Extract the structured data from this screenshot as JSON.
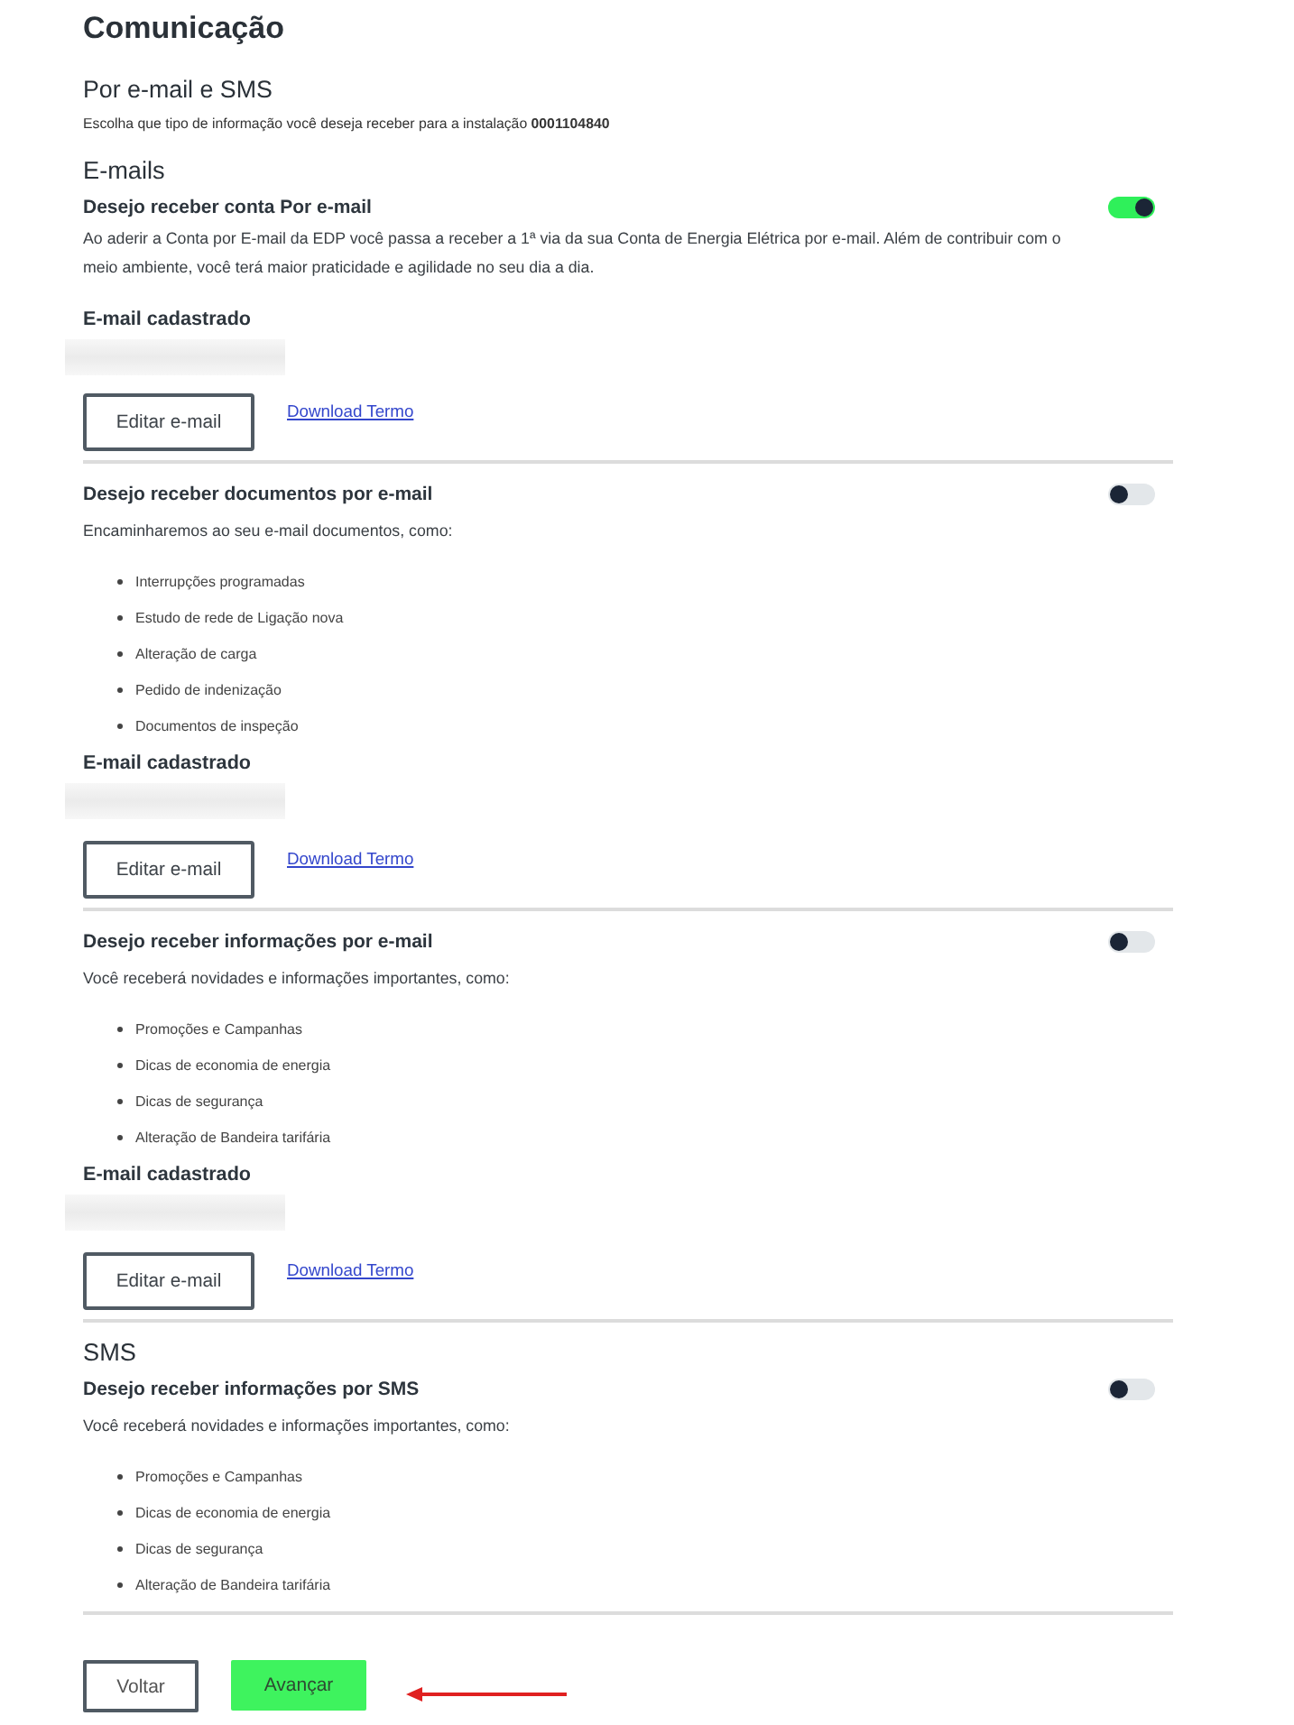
{
  "page": {
    "title": "Comunicação",
    "subtitle": "Por e-mail e SMS",
    "intro": "Escolha que tipo de informação você deseja receber para a instalação **0001104840**"
  },
  "sections": [
    {
      "heading": "E-mails",
      "options": [
        {
          "title": "Desejo receber conta Por e-mail",
          "on": true,
          "description": "Ao aderir a Conta por E-mail da EDP você passa a receber a 1ª via da sua Conta de Energia Elétrica por e-mail. Além de contribuir com o meio ambiente, você terá maior praticidade e agilidade no seu dia a dia.",
          "email": {
            "label": "E-mail cadastrado",
            "edit_button": "Editar e-mail",
            "link": "Download Termo"
          }
        },
        {
          "title": "Desejo receber documentos por e-mail",
          "on": false,
          "description": "Encaminharemos ao seu e-mail documentos, como:",
          "items": [
            "Interrupções programadas",
            "Estudo de rede de Ligação nova",
            "Alteração de carga",
            "Pedido de indenização",
            "Documentos de inspeção"
          ],
          "email": {
            "label": "E-mail cadastrado",
            "edit_button": "Editar e-mail",
            "link": "Download Termo"
          }
        },
        {
          "title": "Desejo receber informações por e-mail",
          "on": false,
          "description": "Você receberá novidades e informações importantes, como:",
          "items": [
            "Promoções e Campanhas",
            "Dicas de economia de energia",
            "Dicas de segurança",
            "Alteração de Bandeira tarifária"
          ],
          "email": {
            "label": "E-mail cadastrado",
            "edit_button": "Editar e-mail",
            "link": "Download Termo"
          }
        }
      ]
    },
    {
      "heading": "SMS",
      "options": [
        {
          "title": "Desejo receber informações por SMS",
          "on": false,
          "description": "Você receberá novidades e informações importantes, como:",
          "items": [
            "Promoções e Campanhas",
            "Dicas de economia de energia",
            "Dicas de segurança",
            "Alteração de Bandeira tarifária"
          ]
        }
      ]
    }
  ],
  "footer": {
    "buttons": [
      {
        "label": "Voltar",
        "kind": "secondary"
      },
      {
        "label": "Avançar",
        "kind": "primary"
      }
    ]
  }
}
